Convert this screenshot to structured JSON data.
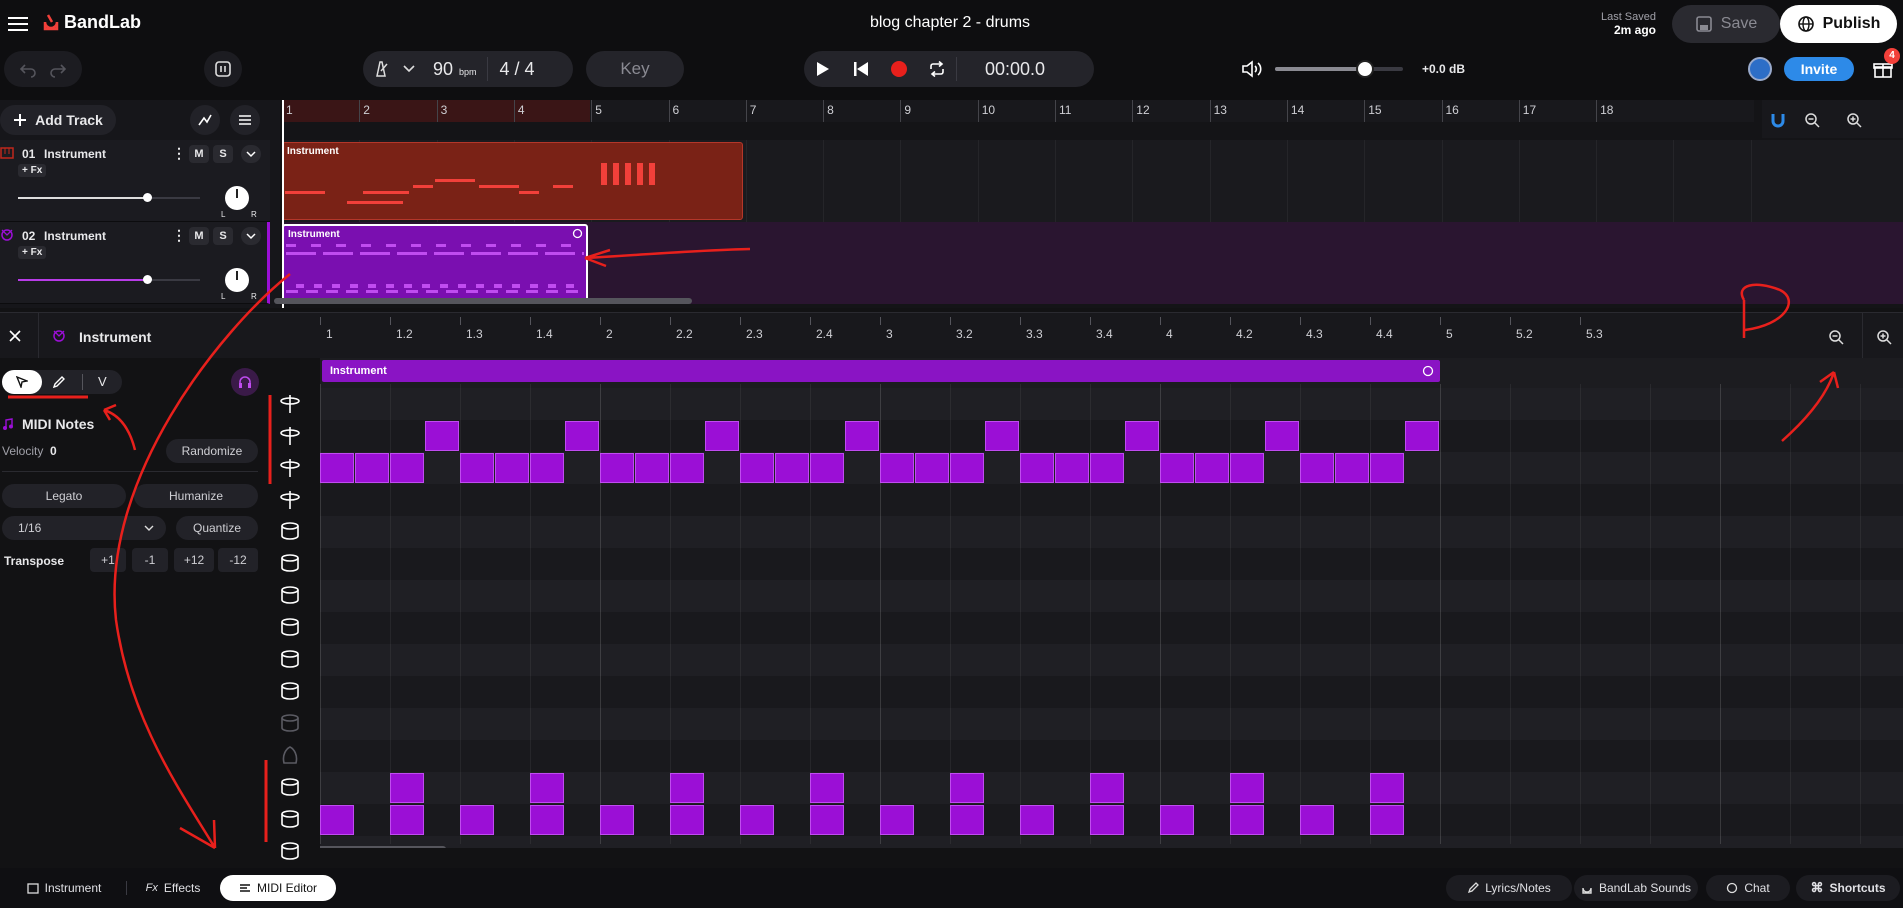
{
  "header": {
    "brand": "BandLab",
    "project_title": "blog chapter 2 - drums",
    "last_saved_label": "Last Saved",
    "last_saved_time": "2m ago",
    "save_label": "Save",
    "publish_label": "Publish",
    "invite_label": "Invite",
    "gift_badge": "4"
  },
  "transport": {
    "tempo": "90",
    "tempo_unit": "bpm",
    "time_sig": "4 / 4",
    "key_label": "Key",
    "time": "00:00.0",
    "volume_db": "+0.0 dB",
    "volume_level": 0.7,
    "record_color": "#e8201c"
  },
  "tracks": {
    "add_track_label": "Add Track",
    "items": [
      {
        "number": "01",
        "name": "Instrument",
        "fx": "+ Fx",
        "mute": "M",
        "solo": "S",
        "pan_l": "L",
        "pan_r": "R",
        "color": "#c0281c"
      },
      {
        "number": "02",
        "name": "Instrument",
        "fx": "+ Fx",
        "mute": "M",
        "solo": "S",
        "pan_l": "L",
        "pan_r": "R",
        "color": "#9b0fd6"
      }
    ],
    "region_names": [
      "Instrument",
      "Instrument"
    ]
  },
  "arrange_ruler": [
    "1",
    "2",
    "3",
    "4",
    "5",
    "6",
    "7",
    "8",
    "9",
    "10",
    "11",
    "12",
    "13",
    "14",
    "15",
    "16",
    "17",
    "18"
  ],
  "editor": {
    "title": "Instrument",
    "section_title": "MIDI Notes",
    "velocity_label": "Velocity",
    "velocity_value": "0",
    "randomize_label": "Randomize",
    "legato_label": "Legato",
    "humanize_label": "Humanize",
    "grid_value": "1/16",
    "quantize_label": "Quantize",
    "transpose_label": "Transpose",
    "transpose_buttons": [
      "+1",
      "-1",
      "+12",
      "-12"
    ],
    "tool_velocity": "V",
    "region_name": "Instrument",
    "ruler": [
      "1",
      "1.2",
      "1.3",
      "1.4",
      "2",
      "2.2",
      "2.3",
      "2.4",
      "3",
      "3.2",
      "3.3",
      "3.4",
      "4",
      "4.2",
      "4.3",
      "4.4",
      "5",
      "5.2",
      "5.3"
    ]
  },
  "bottom_tabs": {
    "instrument": "Instrument",
    "effects": "Effects",
    "midi_editor": "MIDI Editor",
    "lyrics": "Lyrics/Notes",
    "sounds": "BandLab Sounds",
    "chat": "Chat",
    "shortcuts": "Shortcuts"
  }
}
